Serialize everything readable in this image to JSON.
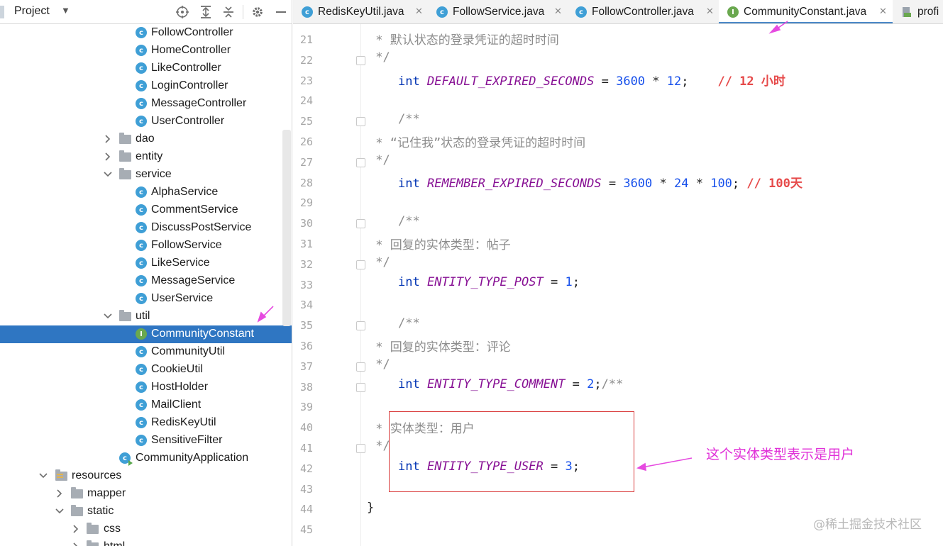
{
  "project_panel": {
    "title": "Project",
    "tree": [
      {
        "label": "FollowController",
        "kind": "class"
      },
      {
        "label": "HomeController",
        "kind": "class"
      },
      {
        "label": "LikeController",
        "kind": "class"
      },
      {
        "label": "LoginController",
        "kind": "class"
      },
      {
        "label": "MessageController",
        "kind": "class"
      },
      {
        "label": "UserController",
        "kind": "class"
      },
      {
        "label": "dao",
        "kind": "folder",
        "state": "collapsed"
      },
      {
        "label": "entity",
        "kind": "folder",
        "state": "collapsed"
      },
      {
        "label": "service",
        "kind": "folder",
        "state": "expanded"
      },
      {
        "label": "AlphaService",
        "kind": "class"
      },
      {
        "label": "CommentService",
        "kind": "class"
      },
      {
        "label": "DiscussPostService",
        "kind": "class"
      },
      {
        "label": "FollowService",
        "kind": "class"
      },
      {
        "label": "LikeService",
        "kind": "class"
      },
      {
        "label": "MessageService",
        "kind": "class"
      },
      {
        "label": "UserService",
        "kind": "class"
      },
      {
        "label": "util",
        "kind": "folder",
        "state": "expanded"
      },
      {
        "label": "CommunityConstant",
        "kind": "interface",
        "selected": true
      },
      {
        "label": "CommunityUtil",
        "kind": "class"
      },
      {
        "label": "CookieUtil",
        "kind": "class"
      },
      {
        "label": "HostHolder",
        "kind": "class"
      },
      {
        "label": "MailClient",
        "kind": "class"
      },
      {
        "label": "RedisKeyUtil",
        "kind": "class"
      },
      {
        "label": "SensitiveFilter",
        "kind": "class"
      },
      {
        "label": "CommunityApplication",
        "kind": "app-class"
      },
      {
        "label": "resources",
        "kind": "resource-folder",
        "state": "expanded"
      },
      {
        "label": "mapper",
        "kind": "folder",
        "state": "collapsed"
      },
      {
        "label": "static",
        "kind": "folder",
        "state": "expanded"
      },
      {
        "label": "css",
        "kind": "folder",
        "state": "collapsed"
      },
      {
        "label": "html",
        "kind": "folder",
        "state": "collapsed"
      }
    ]
  },
  "editor_tabs": [
    {
      "label": "RedisKeyUtil.java",
      "kind": "class"
    },
    {
      "label": "FollowService.java",
      "kind": "class"
    },
    {
      "label": "FollowController.java",
      "kind": "class"
    },
    {
      "label": "CommunityConstant.java",
      "kind": "interface",
      "active": true
    },
    {
      "label": "profi",
      "kind": "file"
    }
  ],
  "editor": {
    "line_numbers": [
      "21",
      "22",
      "23",
      "24",
      "25",
      "26",
      "27",
      "28",
      "29",
      "30",
      "31",
      "32",
      "33",
      "34",
      "35",
      "36",
      "37",
      "38",
      "39",
      "40",
      "41",
      "42",
      "43",
      "44",
      "45"
    ],
    "lines": {
      "l21_comment": " * 默认状态的登录凭证的超时时间",
      "l22_comment": " */",
      "l23_kw": "int",
      "l23_const": "DEFAULT_EXPIRED_SECONDS",
      "l23_eq": " = ",
      "l23_n1": "3600",
      "l23_op": " * ",
      "l23_n2": "12",
      "l23_semi": ";",
      "l23_note": "// 12 小时",
      "l25_comment": "/**",
      "l26_comment": " * “记住我”状态的登录凭证的超时时间",
      "l27_comment": " */",
      "l28_kw": "int",
      "l28_const": "REMEMBER_EXPIRED_SECONDS",
      "l28_eq": " = ",
      "l28_n1": "3600",
      "l28_op1": " * ",
      "l28_n2": "24",
      "l28_op2": " * ",
      "l28_n3": "100",
      "l28_semi": ";",
      "l28_note": "// 100天",
      "l30_comment": "/**",
      "l31_comment": " * 回复的实体类型：帖子",
      "l32_comment": " */",
      "l33_kw": "int",
      "l33_const": "ENTITY_TYPE_POST",
      "l33_eq": " = ",
      "l33_n": "1",
      "l33_semi": ";",
      "l35_comment": "/**",
      "l36_comment": " * 回复的实体类型：评论",
      "l37_comment": " */",
      "l38_kw": "int",
      "l38_const": "ENTITY_TYPE_COMMENT",
      "l38_eq": " = ",
      "l38_n": "2",
      "l38_semi": ";",
      "l38_comment": "/**",
      "l40_comment": " * 实体类型：用户",
      "l41_comment": " */",
      "l42_kw": "int",
      "l42_const": "ENTITY_TYPE_USER",
      "l42_eq": " = ",
      "l42_n": "3",
      "l42_semi": ";",
      "l44_brace": "}"
    }
  },
  "annotation_text": "这个实体类型表示是用户",
  "watermark": "@稀土掘金技术社区",
  "colors": {
    "selection": "#2f76c2",
    "keyword": "#0033b3",
    "constant": "#871094",
    "number": "#1750eb",
    "comment": "#8c8c8c",
    "note_red": "#e64a4a",
    "annotation_magenta": "#e030d8",
    "highlight_box": "#d93b3b"
  }
}
